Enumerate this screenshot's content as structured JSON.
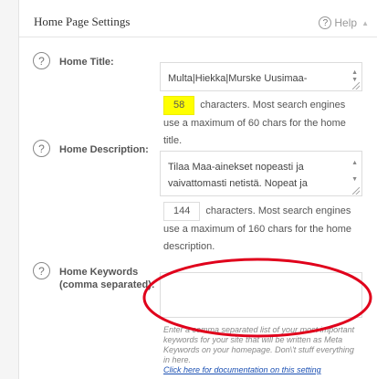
{
  "header": {
    "title": "Home Page Settings",
    "help_icon": "?",
    "help_label": "Help",
    "collapse_icon": "▲"
  },
  "help_icon_glyph": "?",
  "fields": {
    "home_title": {
      "label": "Home Title:",
      "value": "Multa|Hiekka|Murske Uusimaa-",
      "count": "58",
      "count_text": "characters. Most search engines use a maximum of 60 chars for the home title."
    },
    "home_description": {
      "label": "Home Description:",
      "value": "Tilaa Maa-ainekset nopeasti ja vaivattomasti netistä. Nopeat ja",
      "count": "144",
      "count_text": "characters. Most search engines use a maximum of 160 chars for the home description."
    },
    "home_keywords": {
      "label_line1": "Home Keywords",
      "label_line2": "(comma separated):",
      "value": "",
      "description": "Enter a comma separated list of your most important keywords for your site that will be written as Meta Keywords on your homepage. Don\\'t stuff everything in here.",
      "doc_link": "Click here for documentation on this setting"
    }
  },
  "colors": {
    "highlight": "#ffff00",
    "annotation": "#e0001b",
    "link": "#1a4fb3"
  }
}
